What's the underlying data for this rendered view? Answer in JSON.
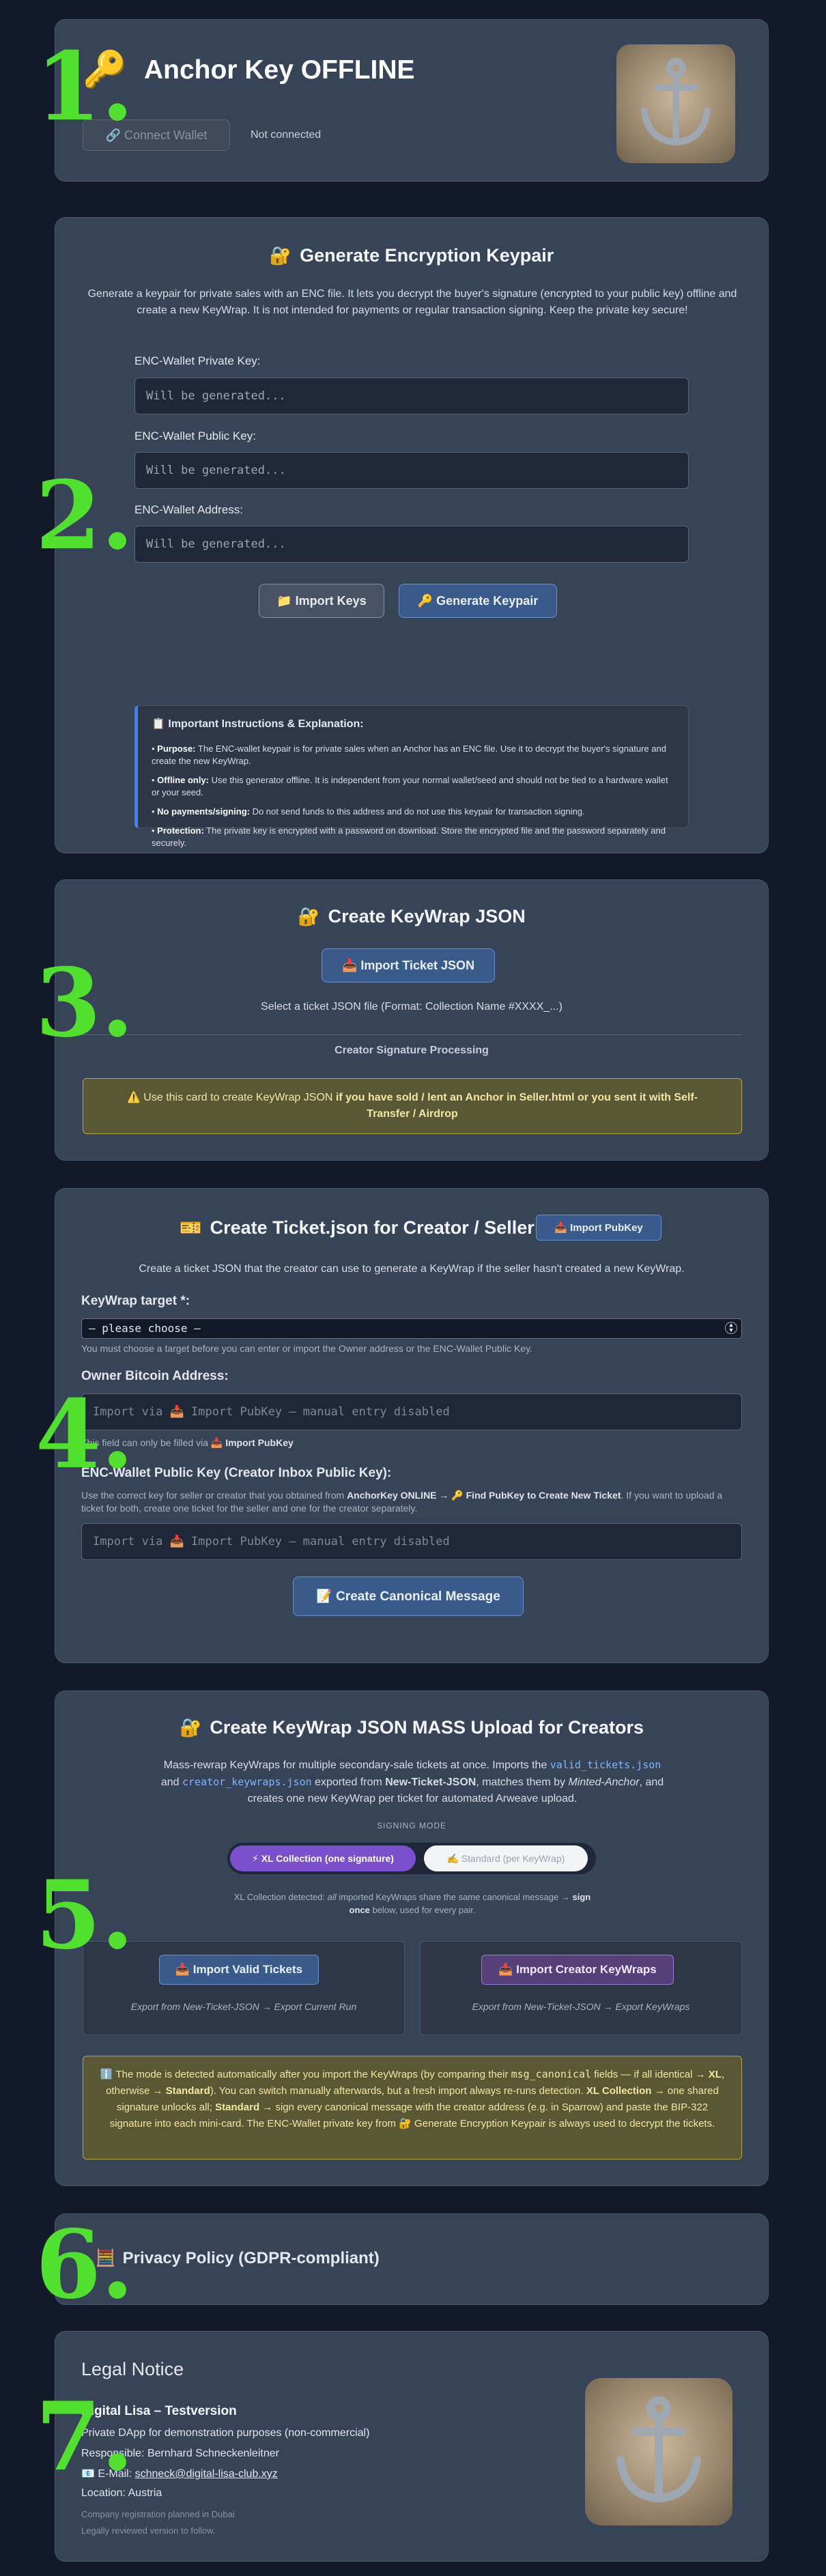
{
  "numbers": [
    "1.",
    "2.",
    "3.",
    "4.",
    "5.",
    "6.",
    "7."
  ],
  "header": {
    "key_icon": "🔑",
    "title": "Anchor Key OFFLINE",
    "connect_button": "🔗 Connect Wallet",
    "status": "Not connected",
    "logo": "anchor-icon"
  },
  "keypair": {
    "icon": "🔐",
    "title": "Generate Encryption Keypair",
    "description": "Generate a keypair for private sales with an ENC file. It lets you decrypt the buyer's signature (encrypted to your public key) offline and create a new KeyWrap. It is not intended for payments or regular transaction signing. Keep the private key secure!",
    "fields": [
      {
        "label": "ENC-Wallet Private Key:",
        "placeholder": "Will be generated..."
      },
      {
        "label": "ENC-Wallet Public Key:",
        "placeholder": "Will be generated..."
      },
      {
        "label": "ENC-Wallet Address:",
        "placeholder": "Will be generated..."
      }
    ],
    "import_button": "📁 Import Keys",
    "generate_button": "🔑 Generate Keypair",
    "instructions": {
      "title": "📋 Important Instructions & Explanation:",
      "items": [
        {
          "bold": "Purpose:",
          "text": " The ENC-wallet keypair is for private sales when an Anchor has an ENC file. Use it to decrypt the buyer's signature and create the new KeyWrap."
        },
        {
          "bold": "Offline only:",
          "text": " Use this generator offline. It is independent from your normal wallet/seed and should not be tied to a hardware wallet or your seed."
        },
        {
          "bold": "No payments/signing:",
          "text": " Do not send funds to this address and do not use this keypair for transaction signing."
        },
        {
          "bold": "Protection:",
          "text": " The private key is encrypted with a password on download. Store the encrypted file and the password separately and securely."
        }
      ]
    }
  },
  "keywrap": {
    "icon": "🔐",
    "title": "Create KeyWrap JSON",
    "import_button": "📥 Import Ticket JSON",
    "hint": "Select a ticket JSON file (Format: Collection Name #XXXX_...)",
    "subheading": "Creator Signature Processing",
    "note_prefix": "⚠️ Use this card to create KeyWrap JSON ",
    "note_bold": "if you have sold / lent an Anchor in Seller.html or you sent it with Self-Transfer / Airdrop"
  },
  "ticket": {
    "icon": "🎫",
    "title": "Create Ticket.json for Creator / Seller",
    "pubkey_button": "📥 Import PubKey",
    "description": "Create a ticket JSON that the creator can use to generate a KeyWrap if the seller hasn't created a new KeyWrap.",
    "target_label": "KeyWrap target *:",
    "target_value": "— please choose —",
    "target_hint": "You must choose a target before you can enter or import the Owner address or the ENC-Wallet Public Key.",
    "owner_label": "Owner Bitcoin Address:",
    "owner_placeholder": "Import via 📥 Import PubKey — manual entry disabled",
    "owner_hint_prefix": "This field can only be filled via 📥 ",
    "owner_hint_bold": "Import PubKey",
    "enc_label": "ENC-Wallet Public Key (Creator Inbox Public Key):",
    "enc_hint_1": "Use the correct key for seller or creator that you obtained from ",
    "enc_hint_bold_1": "AnchorKey ONLINE → 🔑 Find PubKey to Create New Ticket",
    "enc_hint_2": ". If you want to upload a ticket for both, create one ticket for the seller and one for the creator separately.",
    "enc_placeholder": "Import via 📥 Import PubKey — manual entry disabled",
    "canonical_button": "📝 Create Canonical Message"
  },
  "mass": {
    "icon": "🔐",
    "title": "Create KeyWrap JSON MASS Upload for Creators",
    "desc_1": "Mass-rewrap KeyWraps for multiple secondary-sale tickets at once. Imports the ",
    "desc_code_1": "valid_tickets.json",
    "desc_2": " and ",
    "desc_code_2": "creator_keywraps.json",
    "desc_3": " exported from ",
    "desc_bold": "New-Ticket-JSON",
    "desc_4": ", matches them by ",
    "desc_ital": "Minted-Anchor",
    "desc_5": ", and creates one new KeyWrap per ticket for automated Arweave upload.",
    "mode_label": "SIGNING MODE",
    "mode_xl": "⚡ XL Collection (one signature)",
    "mode_std": "✍️ Standard (per KeyWrap)",
    "detected_1": "XL Collection detected: ",
    "detected_ital": "all",
    "detected_2": " imported KeyWraps share the same canonical message → ",
    "detected_bold": "sign once",
    "detected_3": " below, used for every pair.",
    "import_valid": "📥 Import Valid Tickets",
    "import_valid_hint": "Export from New-Ticket-JSON → Export Current Run",
    "import_creator": "📥 Import Creator KeyWraps",
    "import_creator_hint": "Export from New-Ticket-JSON → Export KeyWraps",
    "note": {
      "p1": "ℹ️ The mode is detected automatically after you import the KeyWraps (by comparing their ",
      "c1": "msg_canonical",
      "p2": " fields — if all identical → ",
      "b1": "XL",
      "p3": ", otherwise → ",
      "b2": "Standard",
      "p4": "). You can switch manually afterwards, but a fresh import always re-runs detection. ",
      "b3": "XL Collection",
      "p5": " → one shared signature unlocks all; ",
      "b4": "Standard",
      "p6": " → sign every canonical message with the creator address (e.g. in Sparrow) and paste the BIP-322 signature into each mini-card. The ENC-Wallet private key from 🔐 Generate Encryption Keypair is always used to decrypt the tickets."
    }
  },
  "privacy": {
    "arrow": "▶",
    "icon": "🧮",
    "title": "Privacy Policy (GDPR-compliant)"
  },
  "legal": {
    "title": "Legal Notice",
    "name": "Digital Lisa – Testversion",
    "line1": "Private DApp for demonstration purposes (non-commercial)",
    "line2": "Responsible: Bernhard Schneckenleitner",
    "email_prefix": "📧 E-Mail: ",
    "email": "schneck@digital-lisa-club.xyz",
    "line3": "Location: Austria",
    "line4": "Company registration planned in Dubai",
    "line5": "Legally reviewed version to follow."
  },
  "colors": {
    "accent_green": "#52e02f",
    "card_bg": "#374357",
    "page_bg": "#121a2a",
    "xl_mode": "#7c4fcf"
  }
}
